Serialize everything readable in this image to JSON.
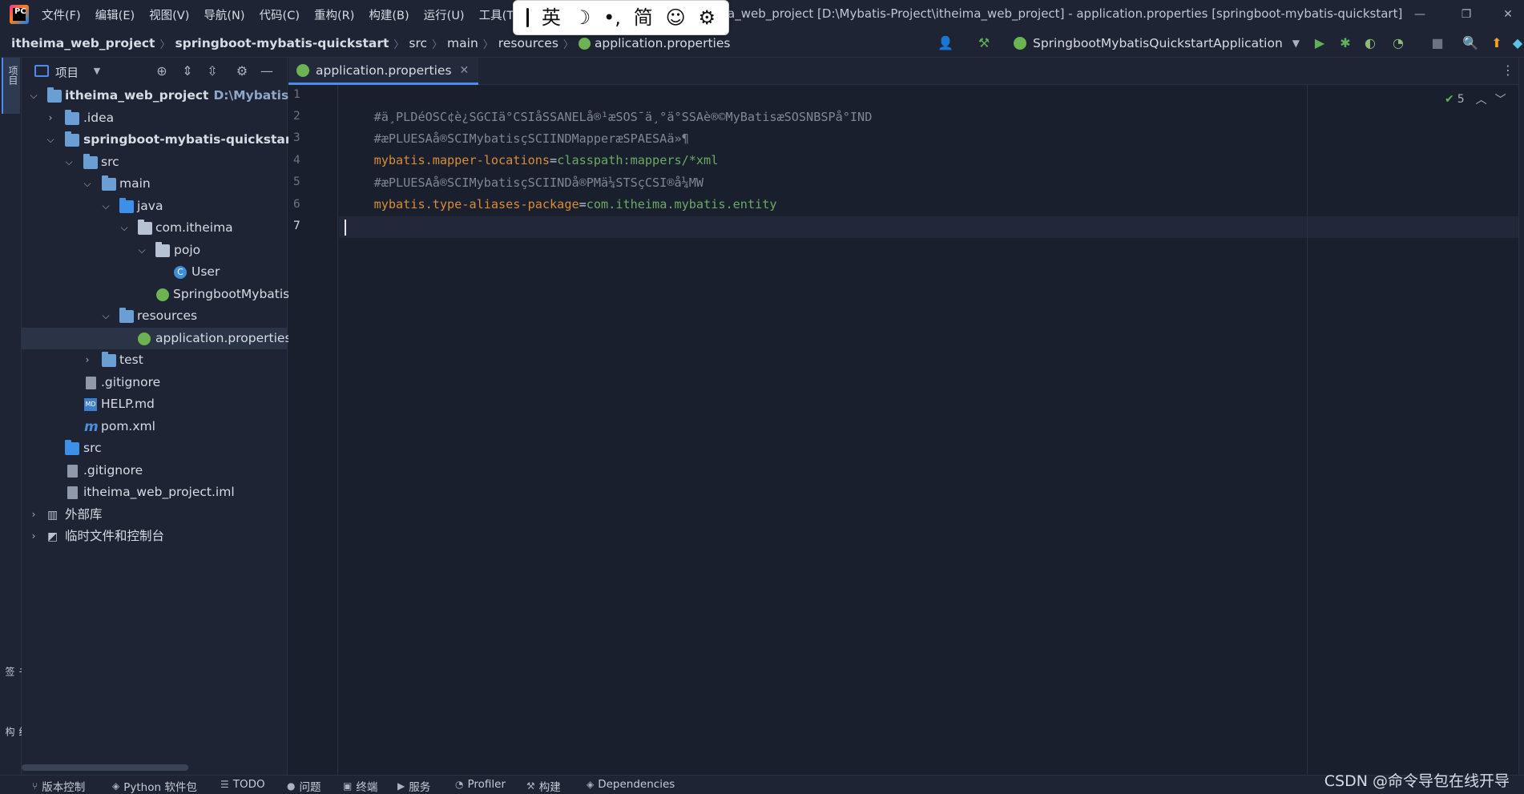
{
  "menu": [
    "文件(F)",
    "编辑(E)",
    "视图(V)",
    "导航(N)",
    "代码(C)",
    "重构(R)",
    "构建(B)",
    "运行(U)",
    "工具(T)"
  ],
  "window_title": "a_web_project [D:\\Mybatis-Project\\itheima_web_project] - application.properties [springboot-mybatis-quickstart]",
  "ime": {
    "lang": "英",
    "moon": "☽",
    "punct": "•,",
    "simp": "简",
    "emoji": "☺",
    "settings": "⚙"
  },
  "breadcrumb": [
    "itheima_web_project",
    "springboot-mybatis-quickstart",
    "src",
    "main",
    "resources",
    "application.properties"
  ],
  "run_config": "SpringbootMybatisQuickstartApplication",
  "panel": {
    "title": "项目"
  },
  "tree": [
    {
      "label": "itheima_web_project",
      "path": "D:\\Mybatis-Proj",
      "bold": true
    },
    {
      "label": ".idea"
    },
    {
      "label": "springboot-mybatis-quickstart",
      "bold": true
    },
    {
      "label": "src"
    },
    {
      "label": "main"
    },
    {
      "label": "java"
    },
    {
      "label": "com.itheima"
    },
    {
      "label": "pojo"
    },
    {
      "label": "User"
    },
    {
      "label": "SpringbootMybatis"
    },
    {
      "label": "resources"
    },
    {
      "label": "application.properties"
    },
    {
      "label": "test"
    },
    {
      "label": ".gitignore"
    },
    {
      "label": "HELP.md"
    },
    {
      "label": "pom.xml"
    },
    {
      "label": "src"
    },
    {
      "label": ".gitignore"
    },
    {
      "label": "itheima_web_project.iml"
    },
    {
      "label": "外部库"
    },
    {
      "label": "临时文件和控制台"
    }
  ],
  "editor": {
    "tab": "application.properties",
    "line_numbers": [
      "1",
      "2",
      "3",
      "4",
      "5",
      "6",
      "7"
    ],
    "lines": {
      "l1": "#ä¸PLDéOSC¢è¿SGCIä°CSIåSSANELå®¹æSOS¯ä¸°ä°SSAè®©MyBatisæSOSNBSPå°IND",
      "l2": "#æPLUESAå®SCIMybatisçSCIINDMapperæSPAESAä»¶",
      "l3_key": "mybatis.mapper-locations",
      "l3_eq": "=",
      "l3_val": "classpath:mappers/*xml",
      "l4": "#æPLUESAå®SCIMybatisçSCIINDå®PMä¼STSçCSI®å¼MW",
      "l5_key": "mybatis.type-aliases-package",
      "l5_eq": "=",
      "l5_val": "com.itheima.mybatis.entity"
    },
    "inspection_count": "5"
  },
  "left_strip": {
    "project": "项目",
    "bookmarks": "书签",
    "structure": "结构"
  },
  "status": [
    "版本控制",
    "Python 软件包",
    "TODO",
    "问题",
    "终端",
    "服务",
    "Profiler",
    "构建",
    "Dependencies"
  ],
  "watermark": "CSDN @命令导包在线开导"
}
